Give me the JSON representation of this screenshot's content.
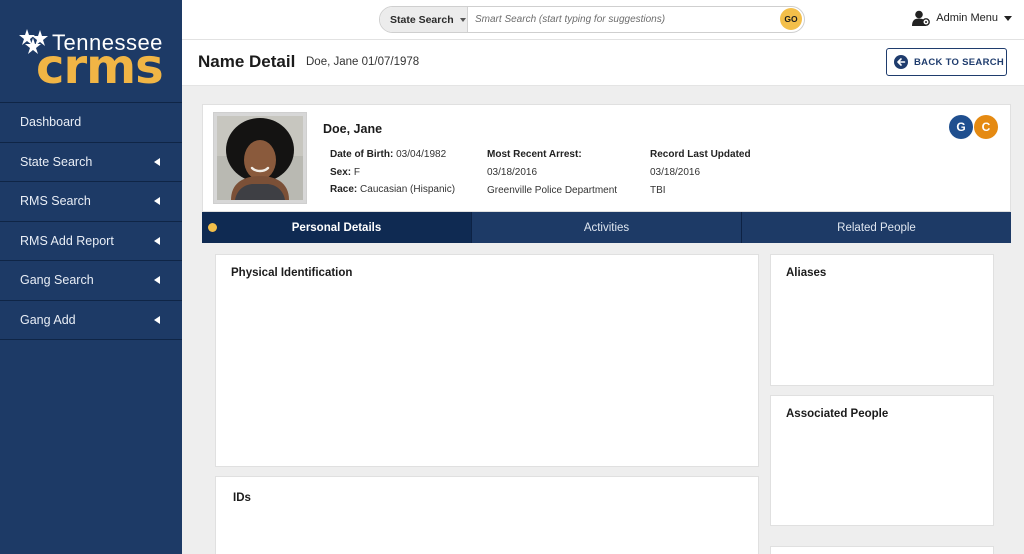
{
  "sidebar": {
    "logo_top": "Tennessee",
    "logo_main": "crms",
    "items": [
      {
        "label": "Dashboard"
      },
      {
        "label": "State Search"
      },
      {
        "label": "RMS Search"
      },
      {
        "label": "RMS Add Report"
      },
      {
        "label": "Gang Search"
      },
      {
        "label": "Gang Add"
      }
    ]
  },
  "topbar": {
    "search_type": "State Search",
    "search_placeholder": "Smart Search (start typing for suggestions)",
    "go_label": "GO",
    "admin_label": "Admin Menu"
  },
  "header": {
    "title": "Name Detail",
    "subtitle": "Doe, Jane 01/07/1978",
    "back_label": "BACK TO SEARCH"
  },
  "profile": {
    "name": "Doe, Jane",
    "dob_label": "Date of Birth:",
    "dob_value": "03/04/1982",
    "sex_label": "Sex:",
    "sex_value": "F",
    "race_label": "Race:",
    "race_value": "Caucasian (Hispanic)",
    "arrest_label": "Most Recent Arrest:",
    "arrest_date": "03/18/2016",
    "arrest_agency": "Greenville Police Department",
    "updated_label": "Record Last Updated",
    "updated_date": "03/18/2016",
    "updated_source": "TBI",
    "badges": [
      {
        "letter": "G",
        "color": "#1f4f8f"
      },
      {
        "letter": "C",
        "color": "#e58a12"
      }
    ]
  },
  "tabs": [
    {
      "label": "Personal Details"
    },
    {
      "label": "Activities"
    },
    {
      "label": "Related People"
    }
  ],
  "panels": {
    "physical_title": "Physical Identification",
    "aliases_title": "Aliases",
    "associated_title": "Associated People",
    "ids_title": "IDs"
  }
}
